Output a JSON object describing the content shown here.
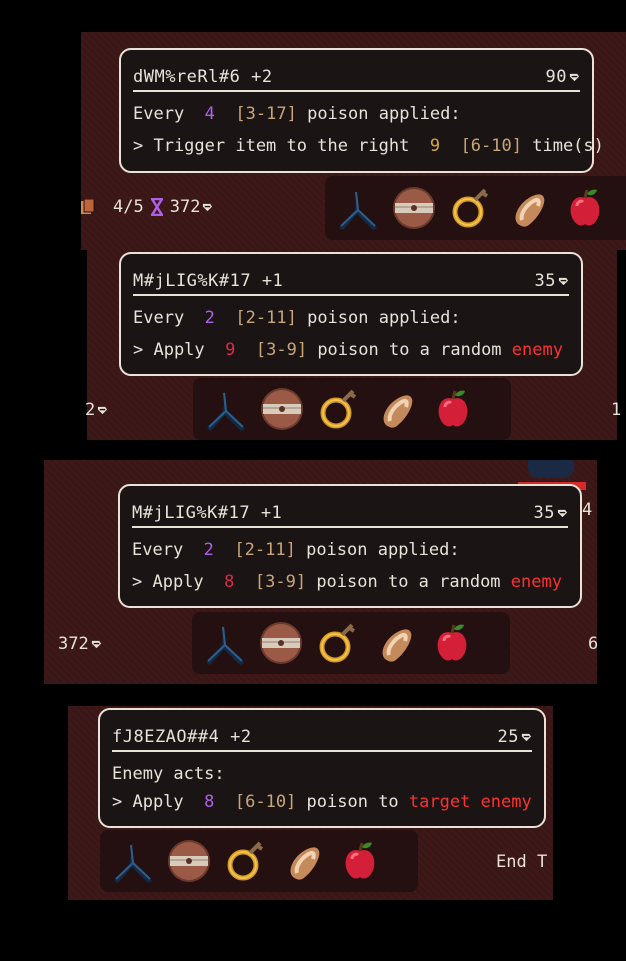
{
  "cards": [
    {
      "name": "dWM%reRl#6 +2",
      "cost": "90",
      "trigger_prefix": "Every",
      "trigger_value": "4",
      "trigger_range": "[3-17]",
      "trigger_suffix": "poison applied:",
      "effect_prefix": "> Trigger item to the right",
      "effect_value": "9",
      "effect_range": "[6-10]",
      "effect_suffix": "time(s)"
    },
    {
      "name": "M#jLIG%K#17 +1",
      "cost": "35",
      "trigger_prefix": "Every",
      "trigger_value": "2",
      "trigger_range": "[2-11]",
      "trigger_suffix": "poison applied:",
      "effect_prefix": "> Apply",
      "effect_value": "9",
      "effect_range": "[3-9]",
      "effect_mid": "poison to a random",
      "effect_target": "enemy"
    },
    {
      "name": "M#jLIG%K#17 +1",
      "cost": "35",
      "trigger_prefix": "Every",
      "trigger_value": "2",
      "trigger_range": "[2-11]",
      "trigger_suffix": "poison applied:",
      "effect_prefix": "> Apply",
      "effect_value": "8",
      "effect_range": "[3-9]",
      "effect_mid": "poison to a random",
      "effect_target": "enemy"
    },
    {
      "name": "fJ8EZAO##4 +2",
      "cost": "25",
      "trigger_text": "Enemy acts:",
      "effect_prefix": "> Apply",
      "effect_value": "8",
      "effect_range": "[6-10]",
      "effect_mid": "poison to",
      "effect_target": "target enemy"
    }
  ],
  "status": {
    "deck": "4/5",
    "gold": "372",
    "gold_short": "2",
    "gold_second": "372",
    "right_digit_1": "1",
    "right_digit_2": "6",
    "right_digit_3": "4",
    "end_turn": "End T"
  },
  "items": [
    "caltrops-icon",
    "shield-icon",
    "ring-icon",
    "bread-icon",
    "apple-icon"
  ],
  "colors": {
    "background": "#3a1616",
    "tray": "#241010",
    "purple": "#b060e8",
    "gold": "#d8a838",
    "red": "#e02848",
    "enemy": "#ff3030"
  }
}
